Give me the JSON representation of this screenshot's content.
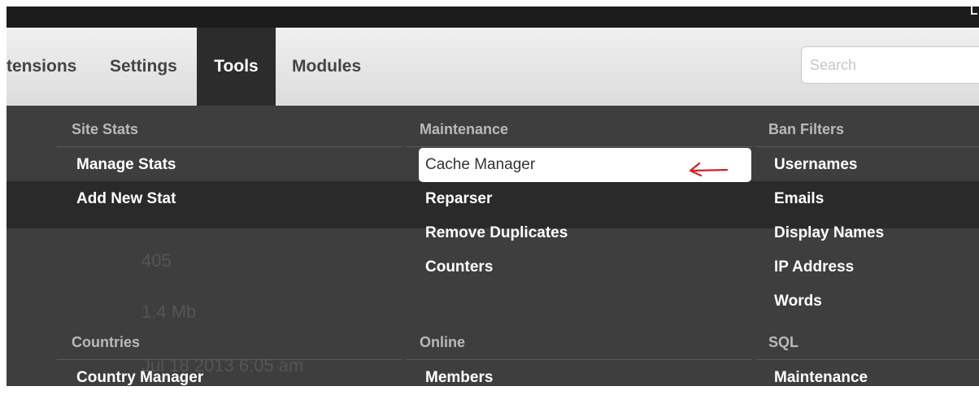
{
  "nav": {
    "tabs": [
      {
        "label": "tensions"
      },
      {
        "label": "Settings"
      },
      {
        "label": "Tools"
      },
      {
        "label": "Modules"
      }
    ],
    "search_placeholder": "Search"
  },
  "background_values": {
    "v1": "405",
    "v2": "1.4 Mb",
    "v3": "Jul 18 2013 6:05 am"
  },
  "sections": {
    "site_stats": {
      "title": "Site Stats",
      "items": [
        "Manage Stats",
        "Add New Stat"
      ]
    },
    "maintenance": {
      "title": "Maintenance",
      "items": [
        "Cache Manager",
        "Reparser",
        "Remove Duplicates",
        "Counters"
      ]
    },
    "ban_filters": {
      "title": "Ban Filters",
      "items": [
        "Usernames",
        "Emails",
        "Display Names",
        "IP Address",
        "Words"
      ]
    },
    "countries": {
      "title": "Countries",
      "items": [
        "Country Manager"
      ]
    },
    "online": {
      "title": "Online",
      "items": [
        "Members"
      ]
    },
    "sql": {
      "title": "SQL",
      "items": [
        "Maintenance"
      ]
    }
  },
  "colors": {
    "annotation_arrow": "#d42020",
    "menu_background": "#3e3e3e",
    "active_tab": "#2c2c2c"
  }
}
